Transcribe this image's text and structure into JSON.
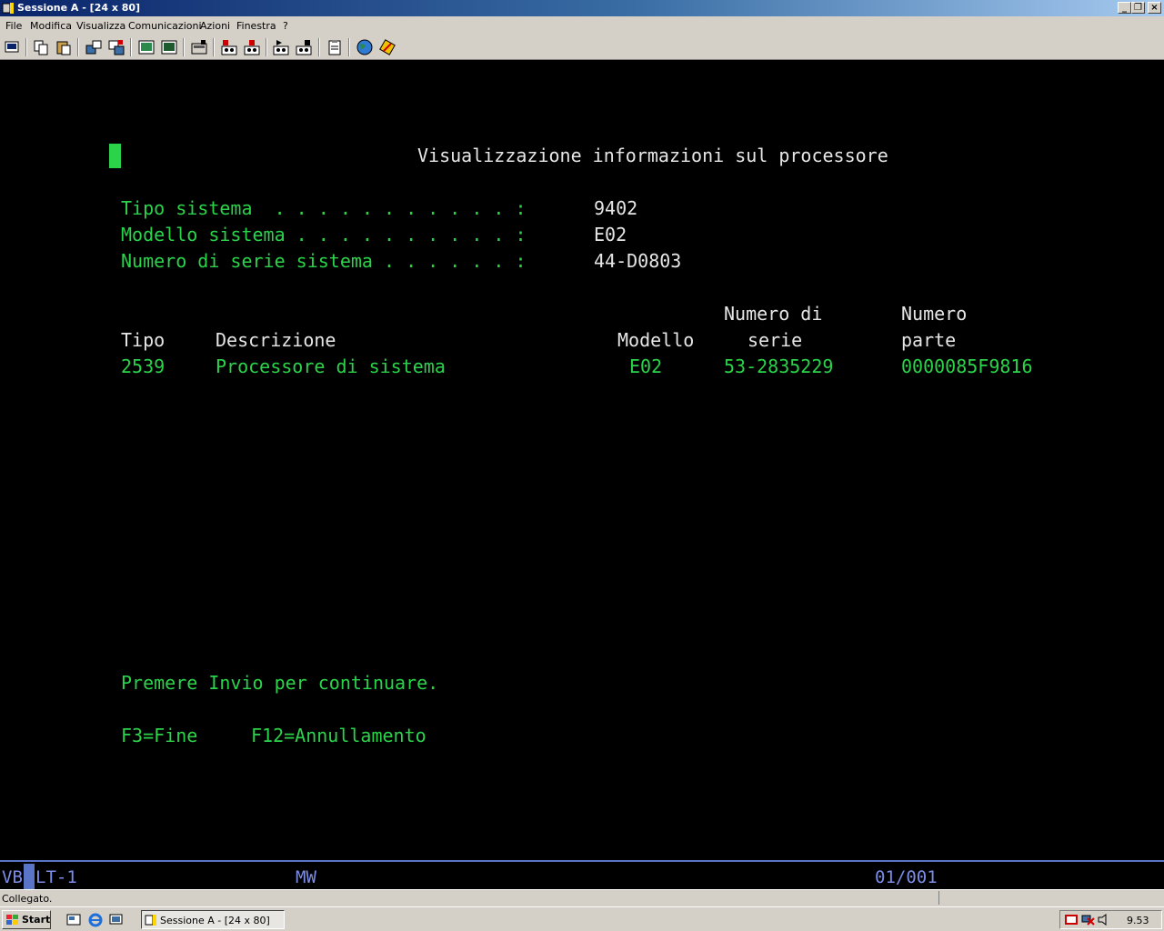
{
  "window": {
    "title": "Sessione A - [24 x 80]",
    "controls": {
      "minimize": "_",
      "restore": "❐",
      "close": "×"
    }
  },
  "menu": [
    "File",
    "Modifica",
    "Visualizza",
    "Comunicazioni",
    "Azioni",
    "Finestra",
    "?"
  ],
  "toolbar": {
    "icons": [
      "print-screen-icon",
      "copy-icon",
      "paste-icon",
      "send-file-icon",
      "receive-file-icon",
      "display-setup-icon",
      "keyboard-map-icon",
      "macro-icon",
      "record-macro-icon",
      "stop-macro-icon",
      "play-macro-icon",
      "pause-macro-icon",
      "clipboard-icon",
      "globe-icon",
      "help-icon"
    ]
  },
  "screen": {
    "title": "Visualizzazione informazioni sul processore",
    "system_type_label": "Tipo sistema  . . . . . . . . . . . :",
    "system_type_value": "9402",
    "system_model_label": "Modello sistema . . . . . . . . . . :",
    "system_model_value": "E02",
    "system_serial_label": "Numero di serie sistema . . . . . . :",
    "system_serial_value": "44-D0803",
    "columns": {
      "serial_top": "Numero di",
      "part_top": "Numero",
      "type": "Tipo",
      "description": "Descrizione",
      "model": "Modello",
      "serial_bottom": "serie",
      "part_bottom": "parte"
    },
    "row": {
      "type": "2539",
      "description": "Processore di sistema",
      "model": "E02",
      "serial": "53-2835229",
      "part": "0000085F9816"
    },
    "prompt": "Premere Invio per continuare.",
    "f3": "F3=Fine",
    "f12": "F12=Annullamento"
  },
  "oia": {
    "left_a": "VB",
    "left_b": "LT-1",
    "mode": "MW",
    "position": "01/001"
  },
  "statusbar": {
    "text": "Collegato."
  },
  "taskbar": {
    "start_label": "Start",
    "task_label": "Sessione A - [24 x 80]",
    "clock": "9.53"
  },
  "colors": {
    "terminal_green": "#2bd34b",
    "terminal_white": "#e6e6e6",
    "oia_blue": "#7b8de6"
  }
}
